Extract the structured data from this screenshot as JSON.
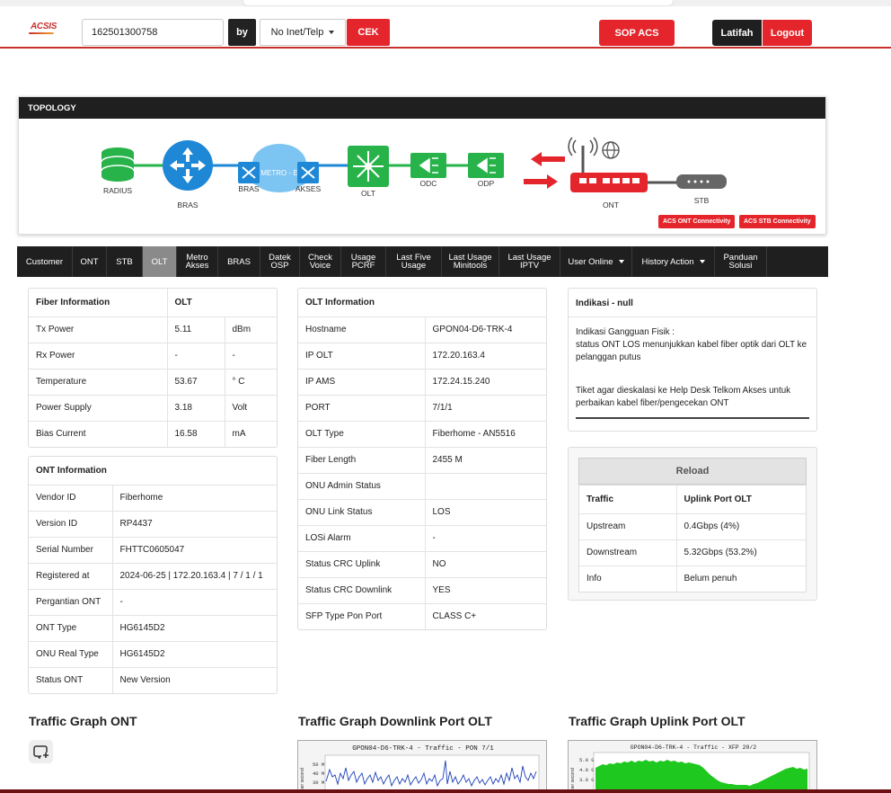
{
  "header": {
    "logo": "ACSIS",
    "search_value": "162501300758",
    "by_label": "by",
    "select_value": "No Inet/Telp",
    "cek_label": "CEK",
    "sop_label": "SOP ACS",
    "user_label": "Latifah",
    "logout_label": "Logout"
  },
  "topology": {
    "title": "TOPOLOGY",
    "nodes": {
      "radius": "RADIUS",
      "bras": "BRAS",
      "bras2": "BRAS",
      "metro": "METRO - E",
      "akses": "AKSES",
      "olt": "OLT",
      "odc": "ODC",
      "odp": "ODP",
      "ont": "ONT",
      "stb": "STB"
    },
    "acs_ont_label": "ACS ONT Connectivity",
    "acs_stb_label": "ACS STB Connectivity",
    "colors": {
      "green": "#27b34a",
      "blue": "#1e88d6",
      "red": "#e4262c",
      "cloud": "#7cc4f2"
    }
  },
  "tabs": [
    {
      "label": "Customer"
    },
    {
      "label": "ONT"
    },
    {
      "label": "STB"
    },
    {
      "label": "OLT",
      "active": true
    },
    {
      "label": "Metro\nAkses"
    },
    {
      "label": "BRAS"
    },
    {
      "label": "Datek\nOSP"
    },
    {
      "label": "Check\nVoice"
    },
    {
      "label": "Usage\nPCRF"
    },
    {
      "label": "Last Five\nUsage"
    },
    {
      "label": "Last Usage\nMinitools"
    },
    {
      "label": "Last Usage\nIPTV"
    },
    {
      "label": "User Online",
      "dropdown": true
    },
    {
      "label": "History Action",
      "dropdown": true
    },
    {
      "label": "Panduan\nSolusi"
    }
  ],
  "fiber": {
    "header": [
      "Fiber Information",
      "OLT"
    ],
    "rows": [
      [
        "Tx Power",
        "5.11",
        "dBm"
      ],
      [
        "Rx Power",
        "-",
        "-"
      ],
      [
        "Temperature",
        "53.67",
        "° C"
      ],
      [
        "Power Supply",
        "3.18",
        "Volt"
      ],
      [
        "Bias Current",
        "16.58",
        "mA"
      ]
    ]
  },
  "ont_info": {
    "header": "ONT Information",
    "rows": [
      [
        "Vendor ID",
        "Fiberhome"
      ],
      [
        "Version ID",
        "RP4437"
      ],
      [
        "Serial Number",
        "FHTTC0605047"
      ],
      [
        "Registered at",
        "2024-06-25 | 172.20.163.4 | 7 / 1 / 1"
      ],
      [
        "Pergantian ONT",
        "-"
      ],
      [
        "ONT Type",
        "HG6145D2"
      ],
      [
        "ONU Real Type",
        "HG6145D2"
      ],
      [
        "Status ONT",
        "New Version"
      ]
    ]
  },
  "olt_info": {
    "header": "OLT Information",
    "rows": [
      [
        "Hostname",
        "GPON04-D6-TRK-4"
      ],
      [
        "IP OLT",
        "172.20.163.4"
      ],
      [
        "IP AMS",
        "172.24.15.240"
      ],
      [
        "PORT",
        "7/1/1"
      ],
      [
        "OLT Type",
        "Fiberhome - AN5516"
      ],
      [
        "Fiber Length",
        "2455 M"
      ],
      [
        "ONU Admin Status",
        ""
      ],
      [
        "ONU Link Status",
        "LOS"
      ],
      [
        "LOSi Alarm",
        "-"
      ],
      [
        "Status CRC Uplink",
        "NO"
      ],
      [
        "Status CRC Downlink",
        "YES"
      ],
      [
        "SFP Type Pon Port",
        "CLASS C+"
      ]
    ]
  },
  "indikasi": {
    "header": "Indikasi - null",
    "line1": "Indikasi Gangguan Fisik :",
    "line2": "status ONT LOS menunjukkan kabel fiber optik dari OLT ke pelanggan putus",
    "line3": "Tiket agar dieskalasi ke Help Desk Telkom Akses untuk perbaikan kabel fiber/pengecekan ONT"
  },
  "traffic": {
    "reload_label": "Reload",
    "header": [
      "Traffic",
      "Uplink Port OLT"
    ],
    "rows": [
      [
        "Upstream",
        "0.4Gbps (4%)"
      ],
      [
        "Downstream",
        "5.32Gbps (53.2%)"
      ],
      [
        "Info",
        "Belum penuh"
      ]
    ]
  },
  "graphs": {
    "ont_title": "Traffic Graph ONT",
    "downlink_title": "Traffic Graph Downlink Port OLT",
    "uplink_title": "Traffic Graph Uplink Port OLT",
    "downlink_caption": "GPON04-D6-TRK-4 - Traffic - PON 7/1",
    "uplink_caption": "GPON04-D6-TRK-4 - Traffic - XFP 20/2",
    "downlink_yticks": [
      "50 M",
      "40 M",
      "30 M"
    ],
    "uplink_yticks": [
      "5.0 G",
      "4.0 G",
      "3.0 G"
    ],
    "axis_label": "per second"
  }
}
